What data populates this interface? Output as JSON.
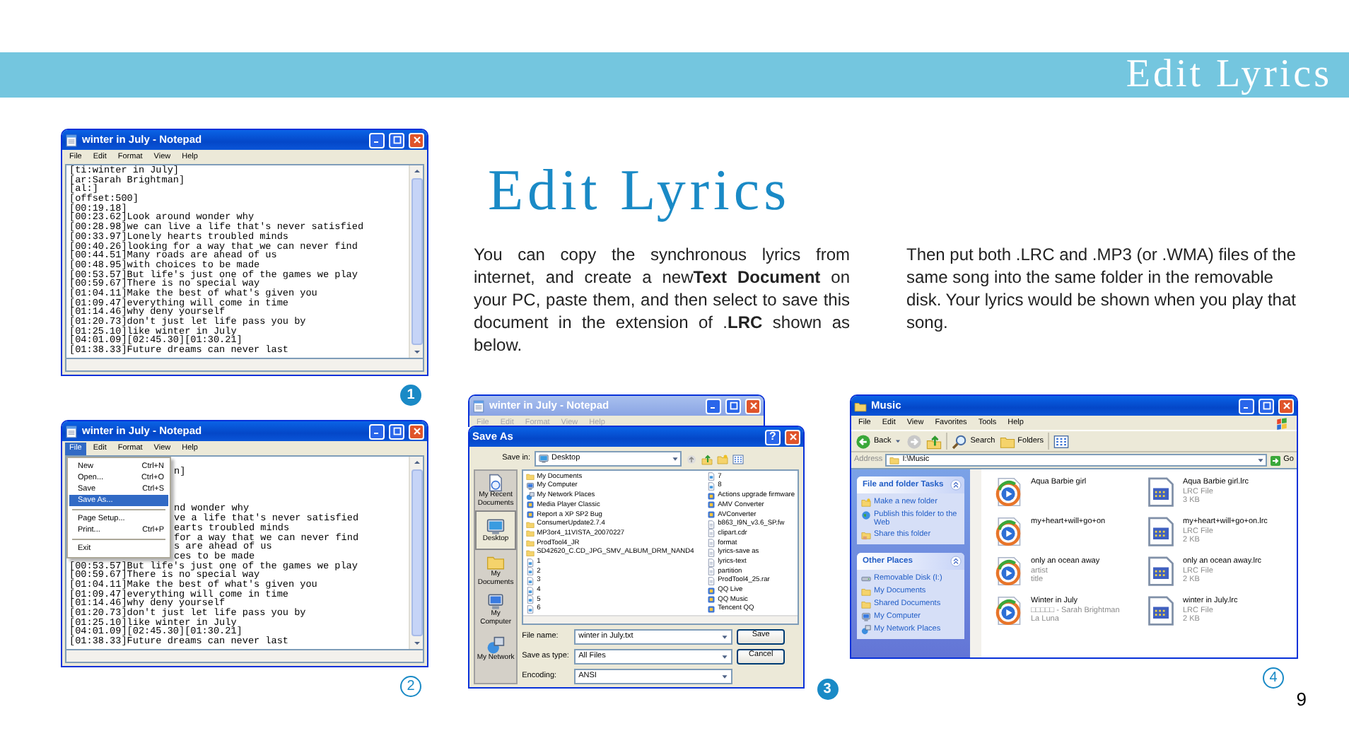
{
  "header": {
    "title": "Edit Lyrics"
  },
  "page_title": "Edit Lyrics",
  "paragraphs": [
    "You can copy the synchronous lyrics from internet, and create a new**Text Document** on your PC, paste them, and then select to save this document in the extension of .**LRC** shown as below.",
    "Then put both .LRC and .MP3 (or .WMA) files of the same song into the same folder in the removable disk. Your lyrics would be shown when you play that song."
  ],
  "screenshots": [
    {
      "kind": "notepad",
      "badge": {
        "label": "1",
        "kind": "filled"
      },
      "title": "winter in July - Notepad",
      "menu": [
        {
          "label": "File",
          "selected": false
        },
        {
          "label": "Edit",
          "selected": false
        },
        {
          "label": "Format",
          "selected": false
        },
        {
          "label": "View",
          "selected": false
        },
        {
          "label": "Help",
          "selected": false
        }
      ],
      "lines": [
        "[ti:winter in July]",
        "[ar:Sarah Brightman]",
        "[al:]",
        "[offset:500]",
        "[00:19.18]",
        "[00:23.62]Look around wonder why",
        "[00:28.98]we can live a life that's never satisfied",
        "[00:33.97]Lonely hearts troubled minds",
        "[00:40.26]looking for a way that we can never find",
        "[00:44.51]Many roads are ahead of us",
        "[00:48.95]with choices to be made",
        "[00:53.57]But life's just one of the games we play",
        "[00:59.67]There is no special way",
        "[01:04.11]Make the best of what's given you",
        "[01:09.47]everything will come in time",
        "[01:14.46]why deny yourself",
        "[01:20.73]don't just let life pass you by",
        "[01:25.10]like winter in July",
        "[04:01.09][02:45.30][01:30.21]",
        "[01:38.33]Future dreams can never last"
      ]
    },
    {
      "kind": "notepad",
      "badge": {
        "label": "2",
        "kind": "outline"
      },
      "title": "winter in July - Notepad",
      "menu": [
        {
          "label": "File",
          "selected": true
        },
        {
          "label": "Edit",
          "selected": false
        },
        {
          "label": "Format",
          "selected": false
        },
        {
          "label": "View",
          "selected": false
        },
        {
          "label": "Help",
          "selected": false
        }
      ],
      "file_menu": [
        {
          "kind": "item",
          "label": "New",
          "shortcut": "Ctrl+N",
          "selected": false
        },
        {
          "kind": "item",
          "label": "Open...",
          "shortcut": "Ctrl+O",
          "selected": false
        },
        {
          "kind": "item",
          "label": "Save",
          "shortcut": "Ctrl+S",
          "selected": false
        },
        {
          "kind": "item",
          "label": "Save As...",
          "selected": true
        },
        {
          "kind": "separator"
        },
        {
          "kind": "item",
          "label": "Page Setup...",
          "selected": false
        },
        {
          "kind": "item",
          "label": "Print...",
          "shortcut": "Ctrl+P",
          "selected": false
        },
        {
          "kind": "separator"
        },
        {
          "kind": "item",
          "label": "Exit",
          "selected": false
        }
      ],
      "covered_lines": [
        [
          "n]"
        ],
        [
          "nd wonder why",
          "ve a life that's never satisfied",
          "earts troubled minds",
          "for a way that we can never find",
          "s are ahead of us",
          "ces to be made"
        ]
      ],
      "lines": [
        "[00:53.57]But life's just one of the games we play",
        "[00:59.67]There is no special way",
        "[01:04.11]Make the best of what's given you",
        "[01:09.47]everything will come in time",
        "[01:14.46]why deny yourself",
        "[01:20.73]don't just let life pass you by",
        "[01:25.10]like winter in July",
        "[04:01.09][02:45.30][01:30.21]",
        "[01:38.33]Future dreams can never last"
      ]
    },
    {
      "kind": "save_as",
      "badge": {
        "label": "3",
        "kind": "filled"
      },
      "background_window": {
        "title": "winter in July - Notepad",
        "active": false,
        "menu": [
          "File",
          "Edit",
          "Format",
          "View",
          "Help"
        ]
      },
      "title": "Save As",
      "help_button": "?",
      "save_in_label": "Save in:",
      "save_in": "Desktop",
      "places": [
        {
          "label": "My Recent Documents",
          "kind": "recent",
          "selected": false
        },
        {
          "label": "Desktop",
          "kind": "desktop",
          "selected": true
        },
        {
          "label": "My Documents",
          "kind": "folder",
          "selected": false
        },
        {
          "label": "My Computer",
          "kind": "computer",
          "selected": false
        },
        {
          "label": "My Network",
          "kind": "network",
          "selected": false
        }
      ],
      "file_columns": [
        [
          {
            "name": "My Documents",
            "kind": "folder"
          },
          {
            "name": "My Computer",
            "kind": "computer"
          },
          {
            "name": "My Network Places",
            "kind": "network"
          },
          {
            "name": "Media Player Classic",
            "kind": "app"
          },
          {
            "name": "Report a XP SP2 Bug",
            "kind": "app"
          },
          {
            "name": "ConsumerUpdate2.7.4",
            "kind": "folder"
          },
          {
            "name": "MP3or4_11VISTA_20070227",
            "kind": "folder"
          },
          {
            "name": "ProdTool4_JR",
            "kind": "folder"
          },
          {
            "name": "SD42620_C.CD_JPG_SMV_ALBUM_DRM_NAND4",
            "kind": "folder"
          },
          {
            "name": "1",
            "kind": "image"
          },
          {
            "name": "2",
            "kind": "image"
          },
          {
            "name": "3",
            "kind": "image"
          },
          {
            "name": "4",
            "kind": "image"
          },
          {
            "name": "5",
            "kind": "image"
          },
          {
            "name": "6",
            "kind": "image"
          }
        ],
        [
          {
            "name": "7",
            "kind": "image"
          },
          {
            "name": "8",
            "kind": "image"
          },
          {
            "name": "Actions upgrade firmware",
            "kind": "app"
          },
          {
            "name": "AMV Converter",
            "kind": "app"
          },
          {
            "name": "AVConverter",
            "kind": "app"
          },
          {
            "name": "b863_I9N_v3.6_SP.fw",
            "kind": "file"
          },
          {
            "name": "clipart.cdr",
            "kind": "file"
          },
          {
            "name": "format",
            "kind": "file"
          },
          {
            "name": "lyrics-save as",
            "kind": "file"
          },
          {
            "name": "lyrics-text",
            "kind": "file"
          },
          {
            "name": "partition",
            "kind": "file"
          },
          {
            "name": "ProdTool4_25.rar",
            "kind": "file"
          },
          {
            "name": "QQ Live",
            "kind": "app"
          },
          {
            "name": "QQ Music",
            "kind": "app"
          },
          {
            "name": "Tencent QQ",
            "kind": "app"
          }
        ]
      ],
      "fields": [
        {
          "label": "File name:",
          "value": "winter in July.txt",
          "button": "Save"
        },
        {
          "label": "Save as type:",
          "value": "All Files",
          "button": "Cancel"
        },
        {
          "label": "Encoding:",
          "value": "ANSI"
        }
      ]
    },
    {
      "kind": "explorer",
      "badge": {
        "label": "4",
        "kind": "outline"
      },
      "title": "Music",
      "menu": [
        "File",
        "Edit",
        "View",
        "Favorites",
        "Tools",
        "Help"
      ],
      "toolbar": [
        {
          "kind": "back",
          "label": "Back"
        },
        {
          "kind": "forward"
        },
        {
          "kind": "up"
        },
        {
          "kind": "search",
          "label": "Search"
        },
        {
          "kind": "folders",
          "label": "Folders"
        },
        {
          "kind": "views"
        }
      ],
      "address_label": "Address",
      "address": "I:\\Music",
      "go": "Go",
      "task_panels": [
        {
          "title": "File and folder Tasks",
          "links": [
            {
              "label": "Make a new folder",
              "kind": "new-folder"
            },
            {
              "label": "Publish this folder to the Web",
              "kind": "globe"
            },
            {
              "label": "Share this folder",
              "kind": "share"
            }
          ]
        },
        {
          "title": "Other Places",
          "links": [
            {
              "label": "Removable Disk (I:)",
              "kind": "drive"
            },
            {
              "label": "My Documents",
              "kind": "folder"
            },
            {
              "label": "Shared Documents",
              "kind": "folder"
            },
            {
              "label": "My Computer",
              "kind": "computer"
            },
            {
              "label": "My Network Places",
              "kind": "network"
            }
          ]
        }
      ],
      "files": [
        {
          "kind": "media",
          "lines": [
            "Aqua Barbie girl"
          ]
        },
        {
          "kind": "lrc",
          "lines": [
            "Aqua Barbie girl.lrc",
            "LRC File",
            "3 KB"
          ]
        },
        {
          "kind": "media",
          "lines": [
            "my+heart+will+go+on"
          ]
        },
        {
          "kind": "lrc",
          "lines": [
            "my+heart+will+go+on.lrc",
            "LRC File",
            "2 KB"
          ]
        },
        {
          "kind": "media",
          "lines": [
            "only an ocean away",
            "artist",
            "title"
          ]
        },
        {
          "kind": "lrc",
          "lines": [
            "only an ocean away.lrc",
            "LRC File",
            "2 KB"
          ]
        },
        {
          "kind": "media",
          "lines": [
            "Winter in July",
            "□□□□□ - Sarah Brightman",
            "La Luna"
          ]
        },
        {
          "kind": "lrc",
          "lines": [
            "winter in July.lrc",
            "LRC File",
            "2 KB"
          ]
        }
      ]
    }
  ],
  "page_number": "9"
}
